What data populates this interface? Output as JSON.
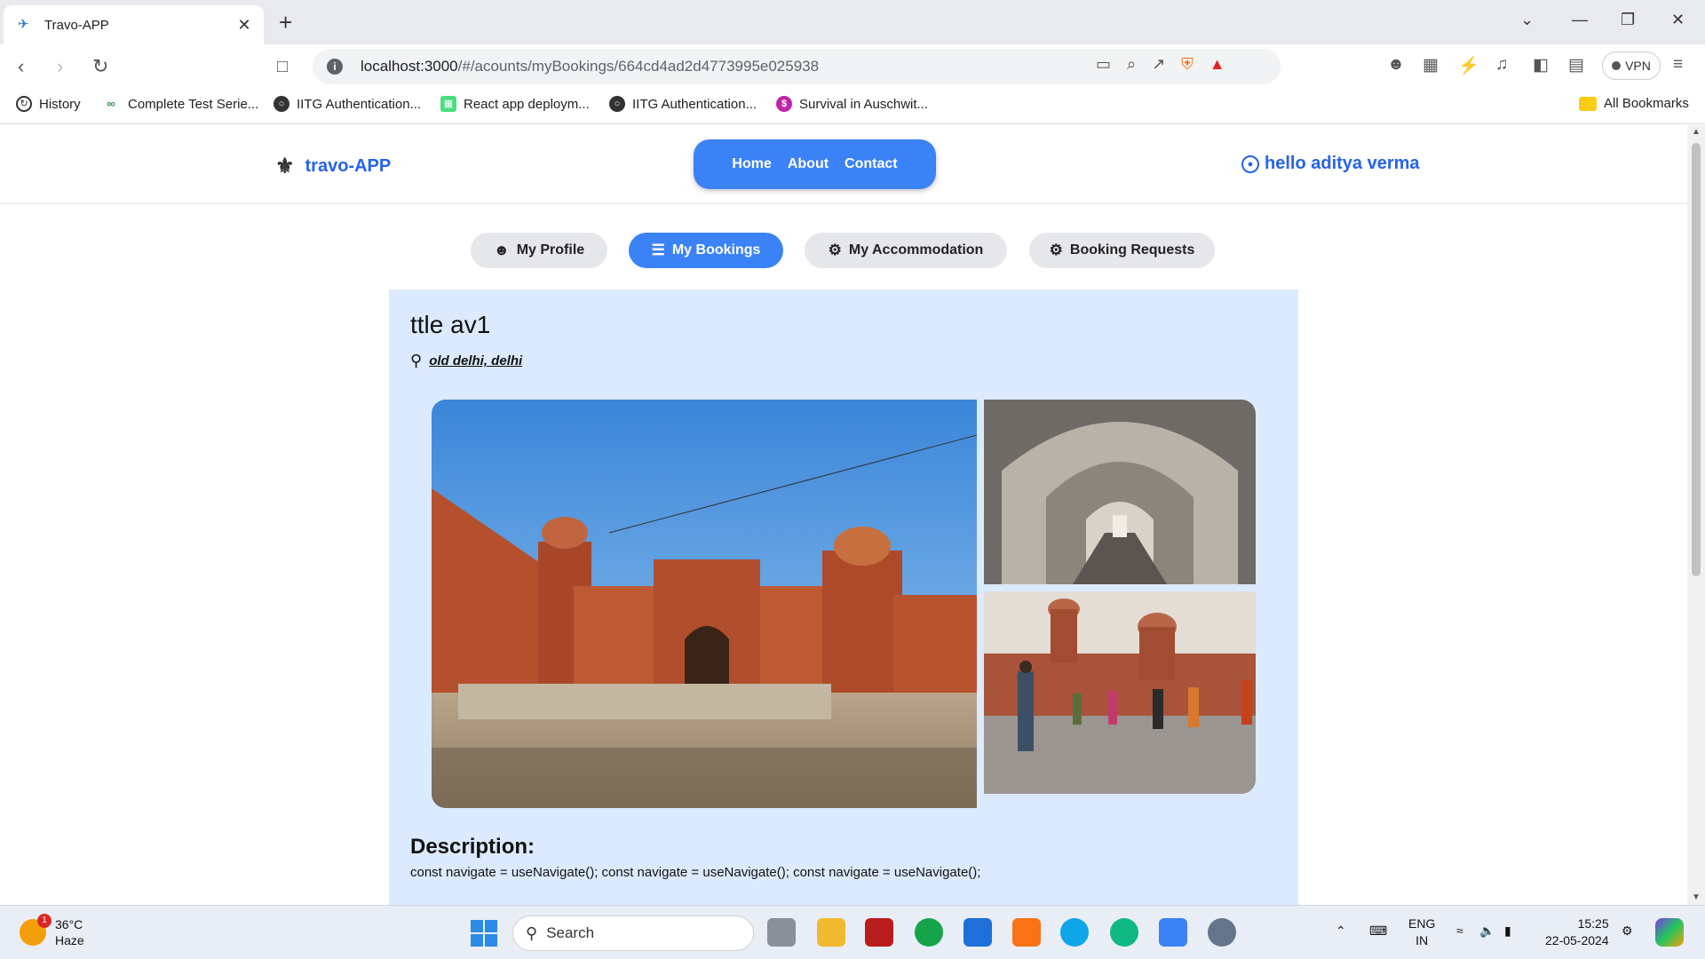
{
  "browser": {
    "tab_title": "Travo-APP",
    "url_host": "localhost:3000",
    "url_path": "/#/acounts/myBookings/664cd4ad2d4773995e025938",
    "vpn_label": "VPN",
    "bookmarks": [
      {
        "label": "History",
        "icon": "history-icon"
      },
      {
        "label": "Complete Test Serie...",
        "icon": "gfg-icon"
      },
      {
        "label": "IITG Authentication...",
        "icon": "globe-icon"
      },
      {
        "label": "React app deploym...",
        "icon": "page-icon"
      },
      {
        "label": "IITG Authentication...",
        "icon": "globe-icon"
      },
      {
        "label": "Survival in Auschwit...",
        "icon": "s-icon"
      }
    ],
    "all_bookmarks_label": "All Bookmarks"
  },
  "site": {
    "logo_text": "travo-APP",
    "nav": [
      "Home",
      "About",
      "Contact"
    ],
    "user_greeting": "hello aditya verma"
  },
  "subtabs": [
    {
      "label": "My Profile",
      "icon": "user-icon",
      "active": false
    },
    {
      "label": "My Bookings",
      "icon": "list-icon",
      "active": true
    },
    {
      "label": "My Accommodation",
      "icon": "building-icon",
      "active": false
    },
    {
      "label": "Booking Requests",
      "icon": "building-icon",
      "active": false
    }
  ],
  "booking": {
    "title": "ttle av1",
    "address": "old delhi, delhi",
    "description_heading": "Description:",
    "description": "const navigate = useNavigate(); const navigate = useNavigate(); const navigate = useNavigate();"
  },
  "taskbar": {
    "temperature": "36°C",
    "weather": "Haze",
    "notification_count": "1",
    "search_label": "Search",
    "lang_1": "ENG",
    "lang_2": "IN",
    "time": "15:25",
    "date": "22-05-2024"
  },
  "colors": {
    "accent": "#3b82f6",
    "link": "#2563eb",
    "card_bg": "#dbeafe"
  }
}
